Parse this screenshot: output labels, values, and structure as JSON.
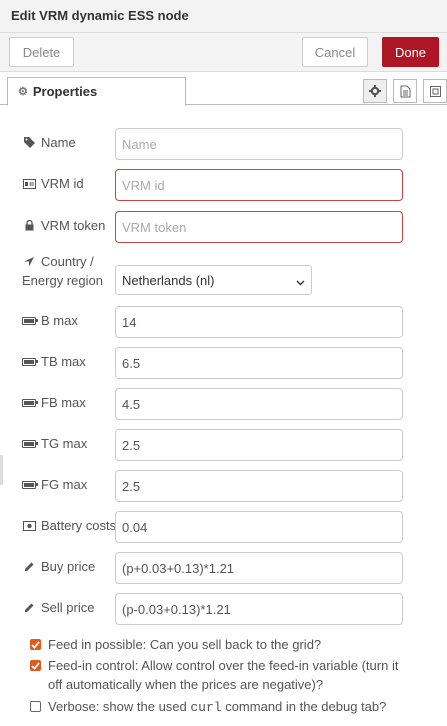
{
  "dialog": {
    "title": "Edit VRM dynamic ESS node"
  },
  "toolbar": {
    "delete_label": "Delete",
    "cancel_label": "Cancel",
    "done_label": "Done"
  },
  "tabs": {
    "properties_label": "Properties"
  },
  "fields": {
    "name": {
      "label": "Name",
      "placeholder": "Name",
      "value": ""
    },
    "vrm_id": {
      "label": "VRM id",
      "placeholder": "VRM id",
      "value": ""
    },
    "vrm_token": {
      "label": "VRM token",
      "placeholder": "VRM token",
      "value": ""
    },
    "country": {
      "label_line1": "Country /",
      "label_line2": "Energy region",
      "value": "Netherlands (nl)"
    },
    "b_max": {
      "label": "B max",
      "value": "14"
    },
    "tb_max": {
      "label": "TB max",
      "value": "6.5"
    },
    "fb_max": {
      "label": "FB max",
      "value": "4.5"
    },
    "tg_max": {
      "label": "TG max",
      "value": "2.5"
    },
    "fg_max": {
      "label": "FG max",
      "value": "2.5"
    },
    "battery_costs": {
      "label": "Battery costs",
      "value": "0.04"
    },
    "buy_price": {
      "label": "Buy price",
      "value": "(p+0.03+0.13)*1.21"
    },
    "sell_price": {
      "label": "Sell price",
      "value": "(p-0.03+0.13)*1.21"
    }
  },
  "checkboxes": {
    "feed_in_possible": {
      "label": "Feed in possible: Can you sell back to the grid?",
      "checked": true
    },
    "feed_in_control": {
      "label": "Feed-in control: Allow control over the feed-in variable (turn it off automatically when the prices are negative)?",
      "checked": true
    },
    "verbose": {
      "label_pre": "Verbose: show the used ",
      "label_code": "curl",
      "label_post": " command in the debug tab?",
      "checked": false
    }
  },
  "colors": {
    "accent": "#ad1625",
    "checkbox": "#e05a1c",
    "invalid_border": "#c04848"
  },
  "icons": {
    "name": "tag-icon",
    "vrm_id": "id-card-icon",
    "vrm_token": "lock-icon",
    "country": "location-arrow-icon",
    "battery": "battery-icon",
    "battery_costs": "money-icon",
    "price": "pencil-icon"
  }
}
